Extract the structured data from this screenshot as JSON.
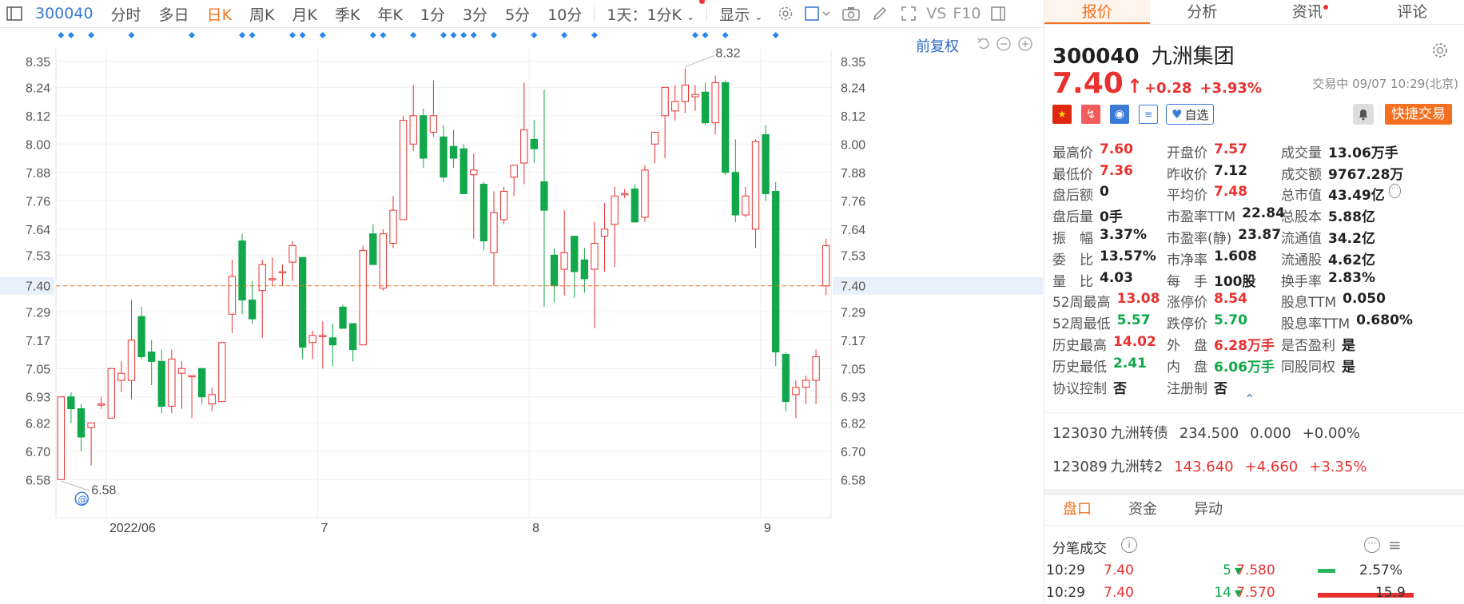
{
  "toolbar": {
    "code": "300040",
    "tabs": [
      "分时",
      "多日",
      "日K",
      "周K",
      "月K",
      "季K",
      "年K",
      "1分",
      "3分",
      "5分",
      "10分"
    ],
    "active_tab": "日K",
    "interval_select": "1天：1分K",
    "display_label": "显示",
    "vs_label": "VS",
    "f10_label": "F10"
  },
  "chart_header": {
    "restore_label": "前复权"
  },
  "chart_data": {
    "type": "candlestick",
    "y_ticks": [
      "8.35",
      "8.24",
      "8.12",
      "8.00",
      "7.88",
      "7.76",
      "7.64",
      "7.53",
      "7.40",
      "7.29",
      "7.17",
      "7.05",
      "6.93",
      "6.82",
      "6.70",
      "6.58"
    ],
    "ylim": [
      6.52,
      8.4
    ],
    "x_labels": [
      "2022/06",
      "7",
      "8",
      "9"
    ],
    "x_label_index": [
      5,
      26,
      47,
      70
    ],
    "current_price": 7.4,
    "current_price_label": "7.40",
    "high_marker": "8.32",
    "low_marker": "6.58",
    "up_color": "#e8312f",
    "down_color": "#11a74a",
    "ohlc": [
      [
        6.58,
        6.93,
        6.58,
        6.93
      ],
      [
        6.93,
        6.95,
        6.82,
        6.88
      ],
      [
        6.88,
        6.9,
        6.7,
        6.76
      ],
      [
        6.8,
        6.82,
        6.64,
        6.82
      ],
      [
        6.9,
        6.93,
        6.88,
        6.9
      ],
      [
        6.84,
        7.05,
        6.84,
        7.05
      ],
      [
        7.0,
        7.08,
        6.95,
        7.03
      ],
      [
        7.0,
        7.34,
        6.92,
        7.17
      ],
      [
        7.27,
        7.31,
        7.09,
        7.1
      ],
      [
        7.12,
        7.17,
        6.98,
        7.08
      ],
      [
        7.08,
        7.13,
        6.86,
        6.89
      ],
      [
        6.89,
        7.13,
        6.86,
        7.09
      ],
      [
        7.03,
        7.08,
        6.88,
        7.05
      ],
      [
        7.02,
        7.02,
        6.84,
        7.02
      ],
      [
        7.05,
        7.05,
        6.9,
        6.93
      ],
      [
        6.9,
        6.97,
        6.87,
        6.94
      ],
      [
        6.91,
        7.16,
        6.91,
        7.16
      ],
      [
        7.28,
        7.51,
        7.2,
        7.44
      ],
      [
        7.59,
        7.62,
        7.28,
        7.34
      ],
      [
        7.34,
        7.42,
        7.24,
        7.26
      ],
      [
        7.38,
        7.51,
        7.18,
        7.49
      ],
      [
        7.43,
        7.52,
        7.4,
        7.43
      ],
      [
        7.46,
        7.49,
        7.4,
        7.46
      ],
      [
        7.5,
        7.59,
        7.42,
        7.57
      ],
      [
        7.52,
        7.52,
        7.09,
        7.14
      ],
      [
        7.16,
        7.21,
        7.09,
        7.19
      ],
      [
        7.19,
        7.25,
        7.05,
        7.19
      ],
      [
        7.18,
        7.24,
        7.06,
        7.15
      ],
      [
        7.31,
        7.32,
        7.22,
        7.22
      ],
      [
        7.24,
        7.24,
        7.08,
        7.13
      ],
      [
        7.15,
        7.57,
        7.15,
        7.55
      ],
      [
        7.62,
        7.66,
        7.5,
        7.49
      ],
      [
        7.39,
        7.64,
        7.38,
        7.62
      ],
      [
        7.58,
        7.78,
        7.56,
        7.72
      ],
      [
        7.68,
        8.12,
        7.68,
        8.1
      ],
      [
        8.0,
        8.25,
        7.97,
        8.12
      ],
      [
        8.12,
        8.15,
        7.9,
        7.94
      ],
      [
        8.05,
        8.27,
        8.03,
        8.12
      ],
      [
        8.03,
        8.08,
        7.84,
        7.86
      ],
      [
        7.99,
        8.06,
        7.9,
        7.94
      ],
      [
        7.98,
        8.0,
        7.79,
        7.79
      ],
      [
        7.87,
        7.96,
        7.6,
        7.89
      ],
      [
        7.83,
        7.84,
        7.55,
        7.59
      ],
      [
        7.54,
        7.8,
        7.4,
        7.71
      ],
      [
        7.68,
        7.82,
        7.66,
        7.8
      ],
      [
        7.86,
        7.9,
        7.78,
        7.91
      ],
      [
        7.92,
        8.26,
        7.83,
        8.06
      ],
      [
        8.02,
        8.1,
        7.92,
        7.98
      ],
      [
        7.84,
        8.23,
        7.31,
        7.72
      ],
      [
        7.53,
        7.56,
        7.33,
        7.4
      ],
      [
        7.47,
        7.72,
        7.36,
        7.54
      ],
      [
        7.61,
        7.61,
        7.35,
        7.46
      ],
      [
        7.51,
        7.56,
        7.37,
        7.43
      ],
      [
        7.47,
        7.67,
        7.22,
        7.58
      ],
      [
        7.61,
        7.75,
        7.46,
        7.64
      ],
      [
        7.66,
        7.82,
        7.48,
        7.78
      ],
      [
        7.79,
        7.81,
        7.77,
        7.79
      ],
      [
        7.81,
        7.83,
        7.72,
        7.67
      ],
      [
        7.69,
        7.91,
        7.67,
        7.89
      ],
      [
        8.0,
        8.02,
        7.92,
        8.05
      ],
      [
        8.12,
        8.17,
        7.94,
        8.24
      ],
      [
        8.14,
        8.25,
        8.1,
        8.18
      ],
      [
        8.18,
        8.32,
        8.13,
        8.25
      ],
      [
        8.2,
        8.25,
        8.14,
        8.21
      ],
      [
        8.22,
        8.26,
        8.08,
        8.09
      ],
      [
        8.09,
        8.29,
        8.04,
        8.26
      ],
      [
        8.26,
        8.27,
        7.87,
        7.88
      ],
      [
        7.88,
        8.02,
        7.67,
        7.7
      ],
      [
        7.7,
        7.82,
        7.69,
        7.78
      ],
      [
        7.64,
        8.02,
        7.56,
        8.01
      ],
      [
        8.04,
        8.08,
        7.76,
        7.79
      ],
      [
        7.8,
        7.84,
        7.06,
        7.12
      ],
      [
        7.11,
        7.12,
        6.87,
        6.91
      ],
      [
        6.94,
        7.0,
        6.84,
        6.97
      ],
      [
        6.97,
        7.02,
        6.9,
        7.0
      ],
      [
        7.0,
        7.13,
        6.9,
        7.1
      ],
      [
        7.4,
        7.6,
        7.36,
        7.57
      ]
    ],
    "event_marker_index": [
      0,
      1,
      3,
      7,
      13,
      18,
      19,
      23,
      24,
      26,
      31,
      32,
      35,
      38,
      39,
      40,
      41,
      43,
      47,
      50,
      53,
      63,
      64,
      66,
      71
    ]
  },
  "stock": {
    "code": "300040",
    "name": "九洲集团",
    "price": "7.40",
    "change": "+0.28",
    "change_pct": "+3.93%",
    "status": "交易中 09/07 10:29(北京)",
    "watch_label": "自选",
    "quick_trade_label": "快捷交易"
  },
  "right_tabs": [
    "报价",
    "分析",
    "资讯",
    "评论"
  ],
  "quote_rows": [
    [
      {
        "label": "最高价",
        "value": "7.60",
        "color": "red"
      },
      {
        "label": "开盘价",
        "value": "7.57",
        "color": "red"
      },
      {
        "label": "成交量",
        "value": "13.06万手",
        "color": "dark"
      }
    ],
    [
      {
        "label": "最低价",
        "value": "7.36",
        "color": "red"
      },
      {
        "label": "昨收价",
        "value": "7.12",
        "color": "dark"
      },
      {
        "label": "成交额",
        "value": "9767.28万",
        "color": "dark"
      }
    ],
    [
      {
        "label": "盘后额",
        "value": "0",
        "color": "dark"
      },
      {
        "label": "平均价",
        "value": "7.48",
        "color": "red"
      },
      {
        "label": "总市值",
        "value": "43.49亿",
        "color": "dark"
      }
    ],
    [
      {
        "label": "盘后量",
        "value": "0手",
        "color": "dark"
      },
      {
        "label": "市盈率TTM",
        "value": "22.84",
        "color": "dark"
      },
      {
        "label": "总股本",
        "value": "5.88亿",
        "color": "dark"
      }
    ],
    [
      {
        "label": "振　幅",
        "value": "3.37%",
        "color": "dark"
      },
      {
        "label": "市盈率(静)",
        "value": "23.87",
        "color": "dark"
      },
      {
        "label": "流通值",
        "value": "34.2亿",
        "color": "dark"
      }
    ],
    [
      {
        "label": "委　比",
        "value": "13.57%",
        "color": "dark"
      },
      {
        "label": "市净率",
        "value": "1.608",
        "color": "dark"
      },
      {
        "label": "流通股",
        "value": "4.62亿",
        "color": "dark"
      }
    ],
    [
      {
        "label": "量　比",
        "value": "4.03",
        "color": "dark"
      },
      {
        "label": "每　手",
        "value": "100股",
        "color": "dark"
      },
      {
        "label": "换手率",
        "value": "2.83%",
        "color": "dark"
      }
    ],
    [
      {
        "label": "52周最高",
        "value": "13.08",
        "color": "red"
      },
      {
        "label": "涨停价",
        "value": "8.54",
        "color": "red"
      },
      {
        "label": "股息TTM",
        "value": "0.050",
        "color": "dark"
      }
    ],
    [
      {
        "label": "52周最低",
        "value": "5.57",
        "color": "green"
      },
      {
        "label": "跌停价",
        "value": "5.70",
        "color": "green"
      },
      {
        "label": "股息率TTM",
        "value": "0.680%",
        "color": "dark"
      }
    ],
    [
      {
        "label": "历史最高",
        "value": "14.02",
        "color": "red"
      },
      {
        "label": "外　盘",
        "value": "6.28万手",
        "color": "red"
      },
      {
        "label": "是否盈利",
        "value": "是",
        "color": "dark"
      }
    ],
    [
      {
        "label": "历史最低",
        "value": "2.41",
        "color": "green"
      },
      {
        "label": "内　盘",
        "value": "6.06万手",
        "color": "green"
      },
      {
        "label": "同股同权",
        "value": "是",
        "color": "dark"
      }
    ],
    [
      {
        "label": "协议控制",
        "value": "否",
        "color": "dark"
      },
      {
        "label": "注册制",
        "value": "否",
        "color": "dark"
      },
      {
        "label": "",
        "value": "",
        "color": "dark"
      }
    ]
  ],
  "bonds": [
    {
      "code": "123030",
      "name": "九洲转债",
      "price": "234.500",
      "change": "0.000",
      "pct": "+0.00%",
      "color": "dark"
    },
    {
      "code": "123089",
      "name": "九洲转2",
      "price": "143.640",
      "change": "+4.660",
      "pct": "+3.35%",
      "color": "red"
    }
  ],
  "bottom_tabs": [
    "盘口",
    "资金",
    "异动"
  ],
  "trades_title": "分笔成交",
  "trades": [
    {
      "time": "10:29",
      "price": "7.40",
      "vol": "5"
    },
    {
      "time": "10:29",
      "price": "7.40",
      "vol": "14"
    }
  ],
  "depth": [
    {
      "price": "7.580",
      "pct": "2.57%"
    },
    {
      "price": "7.570",
      "pct": "15.9"
    }
  ]
}
